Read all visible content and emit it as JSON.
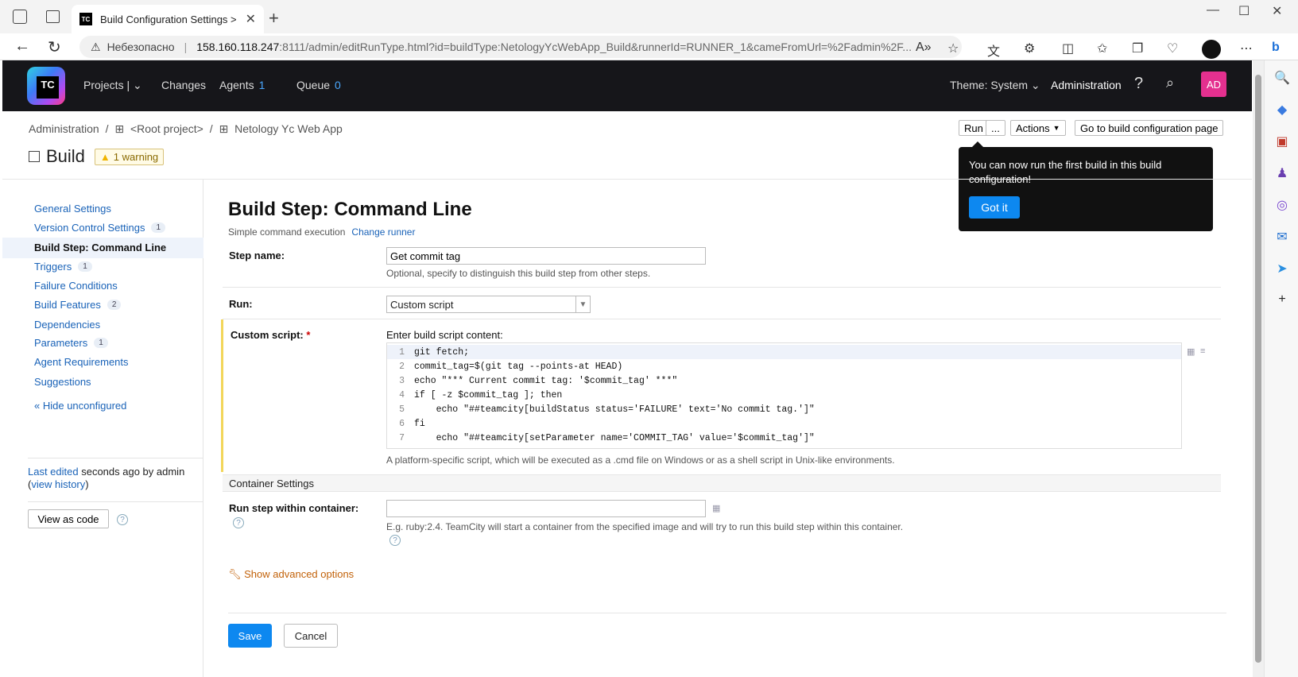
{
  "browser": {
    "tab_title": "Build Configuration Settings > ru",
    "favicon_text": "TC",
    "insecure_label": "Небезопасно",
    "url_host": "158.160.118.247",
    "url_path": ":8111/admin/editRunType.html?id=buildType:NetologyYcWebApp_Build&runnerId=RUNNER_1&cameFromUrl=%2Fadmin%2F..."
  },
  "header": {
    "logo_text": "TC",
    "nav": {
      "projects": "Projects",
      "changes": "Changes",
      "agents": "Agents",
      "agents_count": "1",
      "queue": "Queue",
      "queue_count": "0",
      "theme": "Theme: System",
      "administration": "Administration"
    },
    "avatar_initials": "AD"
  },
  "breadcrumb": {
    "items": [
      "Administration",
      "/",
      "<Root project>",
      "/",
      "Netology Yc Web App"
    ]
  },
  "page": {
    "title": "Build",
    "warning": "1 warning"
  },
  "top_actions": {
    "run": "Run",
    "more": "...",
    "actions": "Actions",
    "goto": "Go to build configuration page"
  },
  "tooltip": {
    "text": "You can now run the first build in this build configuration!",
    "button": "Got it"
  },
  "sidebar": {
    "items": [
      {
        "label": "General Settings",
        "badge": ""
      },
      {
        "label": "Version Control Settings",
        "badge": "1"
      },
      {
        "label": "Build Step: Command Line",
        "badge": ""
      },
      {
        "label": "Triggers",
        "badge": "1"
      },
      {
        "label": "Failure Conditions",
        "badge": ""
      },
      {
        "label": "Build Features",
        "badge": "2"
      },
      {
        "label": "Dependencies",
        "badge": ""
      },
      {
        "label": "Parameters",
        "badge": "1"
      },
      {
        "label": "Agent Requirements",
        "badge": ""
      },
      {
        "label": "Suggestions",
        "badge": ""
      }
    ],
    "hide_unconfigured": "« Hide unconfigured",
    "last_edited_link": "Last edited",
    "last_edited_text": " seconds ago by admin",
    "view_history_open": "(",
    "view_history": "view history",
    "view_history_close": ")",
    "view_as_code": "View as code"
  },
  "form": {
    "title": "Build Step: Command Line",
    "subtitle": "Simple command execution",
    "change_runner": "Change runner",
    "step_name_label": "Step name:",
    "step_name_value": "Get commit tag",
    "step_name_hint": "Optional, specify to distinguish this build step from other steps.",
    "run_label": "Run:",
    "run_value": "Custom script",
    "custom_script_label": "Custom script:",
    "required_mark": " *",
    "script_caption": "Enter build script content:",
    "script_lines": [
      "git fetch;",
      "commit_tag=$(git tag --points-at HEAD)",
      "echo \"*** Current commit tag: '$commit_tag' ***\"",
      "if [ -z $commit_tag ]; then",
      "    echo \"##teamcity[buildStatus status='FAILURE' text='No commit tag.']\"",
      "fi",
      "    echo \"##teamcity[setParameter name='COMMIT_TAG' value='$commit_tag']\""
    ],
    "line_numbers": [
      "1",
      "2",
      "3",
      "4",
      "5",
      "6",
      "7"
    ],
    "script_hint": "A platform-specific script, which will be executed as a .cmd file on Windows or as a shell script in Unix-like environments.",
    "container_section": "Container Settings",
    "container_label": "Run step within container:",
    "container_value": "",
    "container_hint": "E.g. ruby:2.4. TeamCity will start a container from the specified image and will try to run this build step within this container.",
    "advanced": "Show advanced options",
    "save": "Save",
    "cancel": "Cancel"
  },
  "colors": {
    "accent": "#0d88f0",
    "header_bg": "#16161a",
    "link": "#1a63b8",
    "required_highlight": "#f2d65a"
  }
}
